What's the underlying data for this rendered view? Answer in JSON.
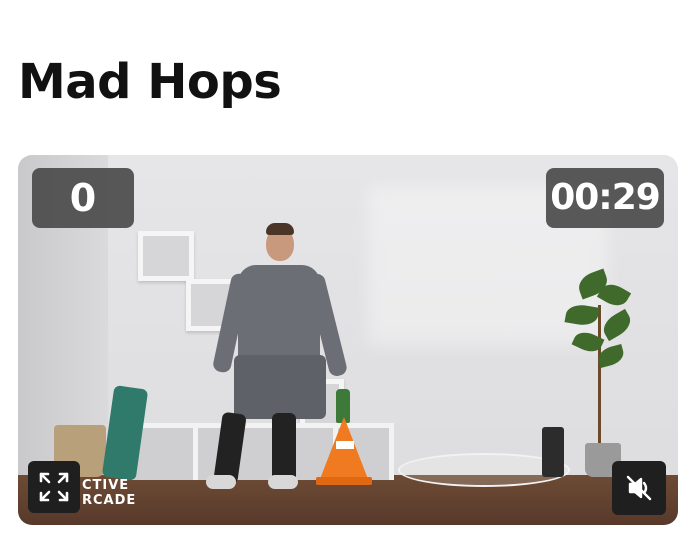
{
  "page": {
    "title": "Mad Hops"
  },
  "video": {
    "score": "0",
    "timer": "00:29",
    "brand_line1": "CTIVE",
    "brand_line2": "RCADE",
    "fullscreen_icon": "fullscreen-icon",
    "mute_icon": "speaker-muted-icon"
  },
  "colors": {
    "overlay_bg": "#4b4b4b",
    "button_bg": "#1f1f1f",
    "text_primary": "#111111",
    "cone": "#f07a1f"
  }
}
